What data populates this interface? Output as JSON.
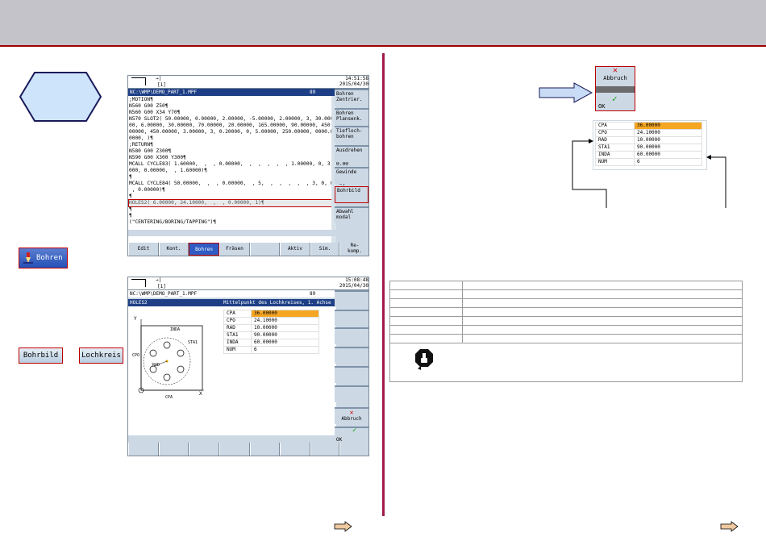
{
  "hexagon_shape": "hexagon",
  "bohren_button": {
    "label": "Bohren",
    "icon": "drill-icon"
  },
  "left_buttons": [
    {
      "label": "Bohrbild"
    },
    {
      "label": "Lochkreis"
    }
  ],
  "screen1": {
    "time": "14:51:58",
    "date": "2015/04/30",
    "channel": "[1]",
    "path": "NC:\\WMP\\DEMO_PART_1.MPF",
    "code_badge": "89",
    "code_lines": [
      ";MOTION¶",
      "N560 G00 Z50¶",
      "N560 G00 X34 Y70¶",
      "N570 SLOT2( 50.00000, 0.00000, 2.00000, -5.00000, 2.00000, 3, 30.000",
      "00, 6.00000, 30.00000, 70.00000, 20.00000, 165.00000, 90.00000, 450.",
      "00000, 450.00000, 3.00000, 3, 0.20000, 0, 5.00000, 250.00000, 0000.0",
      "0000, )¶",
      ";RETURN¶",
      "N580 G00 Z300¶",
      "N590 G00 X300 Y300¶",
      "MCALL CYCLE83( 1.60000,  ,  , 0.00000,  ,  ,  ,  ,  , 1.00000, 0, 3, 0.00",
      "000, 0.00000,  , 1.60000)¶",
      "¶",
      "MCALL CYCLE84( 50.00000,  ,  , 0.00000,  , 5,  ,  ,  ,  ,  , 3, 0, 0, 0,",
      " , 0.00000)¶",
      "¶",
      "HOLES2( 6.00000, 24.10000,  ,  , 0.00000, 1)¶",
      "¶",
      "¶",
      "(\"CENTERING/BORING/TAPPING\")¶"
    ],
    "highlight_line_index": 16,
    "vsoftkeys": [
      "Bohren\nZentrier.",
      "Bohren\nPlansenk.",
      "Tiefloch-\nbohren",
      "Ausdrehen",
      "Gewinde",
      "Bohrbild",
      "Abwahl\nmodal"
    ],
    "hsoftkeys": [
      "Edit",
      "Kont.",
      "Bohren",
      "Fräsen",
      "",
      "Aktiv",
      "Sim.",
      "Re-\nkomp."
    ]
  },
  "screen2": {
    "time": "15:08:48",
    "date": "2015/04/30",
    "channel": "[1]",
    "path": "NC:\\WMP\\DEMO_PART_1.MPF",
    "code_badge": "89",
    "title": "HOLES2",
    "field_hint": "Mittelpunkt des Lochkreises, 1. Achse",
    "params": [
      {
        "name": "CPA",
        "value": "36.00000"
      },
      {
        "name": "CPO",
        "value": "24.10000"
      },
      {
        "name": "RAD",
        "value": "10.00000"
      },
      {
        "name": "STA1",
        "value": "90.00000"
      },
      {
        "name": "INDA",
        "value": "60.00000"
      },
      {
        "name": "NUM",
        "value": "6"
      }
    ],
    "diagram_labels": {
      "y": "Y",
      "x": "X",
      "inda": "INDA",
      "sta1": "STA1",
      "cpo": "CPO",
      "rad": "RAD",
      "cpa": "CPA"
    },
    "abbruch": "Abbruch",
    "ok": "OK"
  },
  "dialog": {
    "abbruch": "Abbruch",
    "ok": "OK"
  },
  "param_table": [
    {
      "name": "CPA",
      "value": "36.00000"
    },
    {
      "name": "CPO",
      "value": "24.10000"
    },
    {
      "name": "RAD",
      "value": "10.00000"
    },
    {
      "name": "STA1",
      "value": "90.00000"
    },
    {
      "name": "INDA",
      "value": "60.00000"
    },
    {
      "name": "NUM",
      "value": "6"
    }
  ],
  "colors": {
    "highlight": "#f5a623",
    "accent": "#c00000",
    "path_bar": "#1e3f86",
    "divider": "#a21a4b",
    "hexagon": "#cde4fb"
  }
}
